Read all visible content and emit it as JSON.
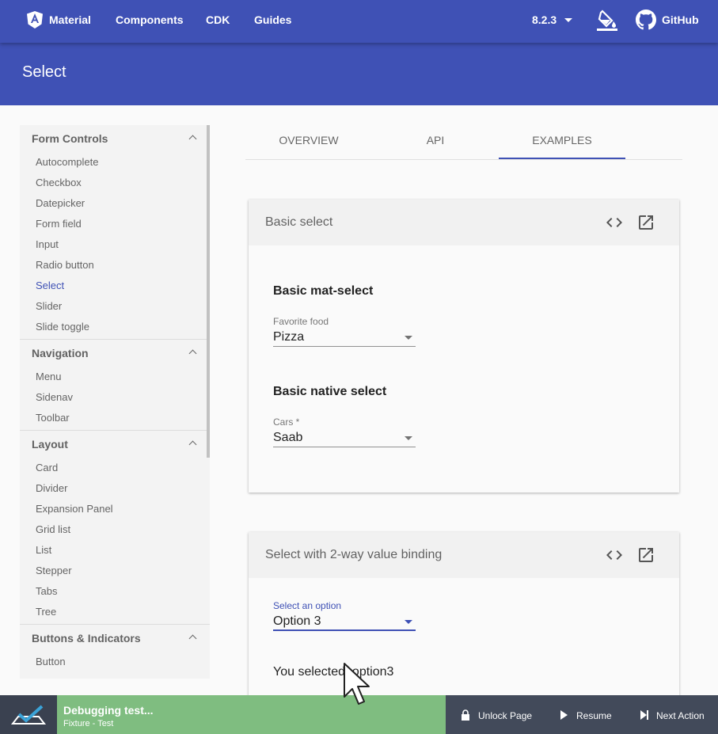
{
  "topbar": {
    "brand": "Material",
    "nav": [
      "Components",
      "CDK",
      "Guides"
    ],
    "version": "8.2.3",
    "github": "GitHub"
  },
  "header": {
    "title": "Select"
  },
  "sidebar": {
    "sections": [
      {
        "title": "Form Controls",
        "items": [
          "Autocomplete",
          "Checkbox",
          "Datepicker",
          "Form field",
          "Input",
          "Radio button",
          "Select",
          "Slider",
          "Slide toggle"
        ]
      },
      {
        "title": "Navigation",
        "items": [
          "Menu",
          "Sidenav",
          "Toolbar"
        ]
      },
      {
        "title": "Layout",
        "items": [
          "Card",
          "Divider",
          "Expansion Panel",
          "Grid list",
          "List",
          "Stepper",
          "Tabs",
          "Tree"
        ]
      },
      {
        "title": "Buttons & Indicators",
        "items": [
          "Button"
        ]
      }
    ],
    "active_item": "Select"
  },
  "tabs": [
    "OVERVIEW",
    "API",
    "EXAMPLES"
  ],
  "active_tab": "EXAMPLES",
  "card1": {
    "title": "Basic select",
    "heading1": "Basic mat-select",
    "field1_label": "Favorite food",
    "field1_value": "Pizza",
    "heading2": "Basic native select",
    "field2_label": "Cars *",
    "field2_value": "Saab"
  },
  "card2": {
    "title": "Select with 2-way value binding",
    "field_label": "Select an option",
    "field_value": "Option 3",
    "selected_text": "You selected: option3"
  },
  "debug": {
    "status": "Debugging test...",
    "fixture": "Fixture - Test",
    "unlock": "Unlock Page",
    "resume": "Resume",
    "next": "Next Action"
  },
  "colors": {
    "primary": "#3f51b5",
    "debug_green": "#7fbd80",
    "debug_bg": "#424a5a"
  }
}
